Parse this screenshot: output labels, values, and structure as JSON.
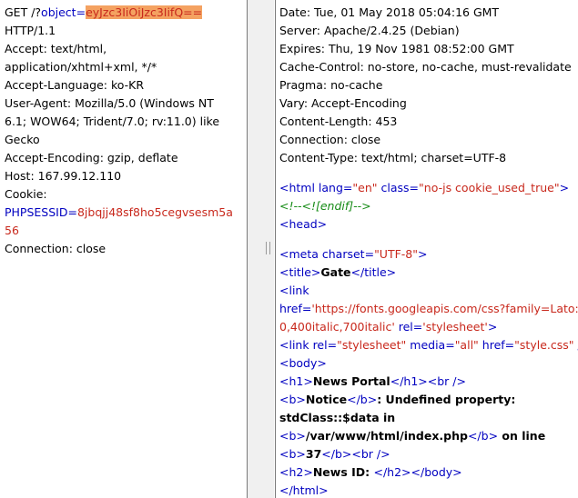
{
  "request": {
    "get_prefix": "GET /?",
    "object_param": "object",
    "equals": "=",
    "object_value": "eyJzc3IiOiJzc3IifQ==",
    "http_version": "HTTP/1.1",
    "accept_1": "Accept: text/html,",
    "accept_2": "application/xhtml+xml, */*",
    "accept_language": "Accept-Language: ko-KR",
    "user_agent_1": "User-Agent: Mozilla/5.0 (Windows NT",
    "user_agent_2": "6.1; WOW64; Trident/7.0; rv:11.0) like",
    "user_agent_3": "Gecko",
    "accept_encoding": "Accept-Encoding: gzip, deflate",
    "host": "Host: 167.99.12.110",
    "cookie": "Cookie:",
    "sessid_name": "PHPSESSID",
    "sessid_value_1": "8jbqjj48sf8ho5cegvsesm5a",
    "sessid_value_2": "56",
    "connection": "Connection: close"
  },
  "response": {
    "headers": [
      "Date: Tue, 01 May 2018 05:04:16 GMT",
      "Server: Apache/2.4.25 (Debian)",
      "Expires: Thu, 19 Nov 1981 08:52:00 GMT",
      "Cache-Control: no-store, no-cache, must-revalidate",
      "Pragma: no-cache",
      "Vary: Accept-Encoding",
      "Content-Length: 453",
      "Connection: close",
      "Content-Type: text/html; charset=UTF-8"
    ],
    "body": {
      "html_lt": "<html ",
      "lang_attr": "lang",
      "lang_val": "\"en\"",
      "class_attr": "class",
      "class_val": "\"no-js cookie_used_true\"",
      "html_gt": ">",
      "comment": "<!--<![endif]-->",
      "head": "<head>",
      "meta_lt": "<meta ",
      "charset_attr": "charset",
      "charset_val": "\"UTF-8\"",
      "meta_gt": ">",
      "title_open": "<title>",
      "title_text": "Gate",
      "title_close": "</title>",
      "link_open": "<link",
      "href_attr": "href",
      "href_val": "'https://fonts.googleapis.com/css?family=Lato:4",
      "href_val_2": "0,400italic,700italic'",
      "rel_attr": "rel",
      "rel_val": "'stylesheet'",
      "link2_lt": "<link ",
      "rel2_attr": "rel",
      "rel2_val": "\"stylesheet\"",
      "media_attr": "media",
      "media_val": "\"all\"",
      "href2_attr": "href",
      "href2_val": "\"style.css\"",
      "slash": " /",
      "body_tag": "<body>",
      "h1_open": "<h1>",
      "h1_text": "News Portal",
      "h1_close": "</h1>",
      "br": "<br />",
      "b_open": "<b>",
      "notice": "Notice",
      "b_close": "</b>",
      "notice_msg": ":  Undefined property:",
      "std_class": "stdClass::$data in",
      "path": "/var/www/html/index.php",
      "on_line": " on line",
      "line_no": "37",
      "h2_open": "<h2>",
      "h2_text": "News ID:  ",
      "h2_close": "</h2>",
      "body_close": "</body>",
      "html_close": "</html>"
    }
  }
}
